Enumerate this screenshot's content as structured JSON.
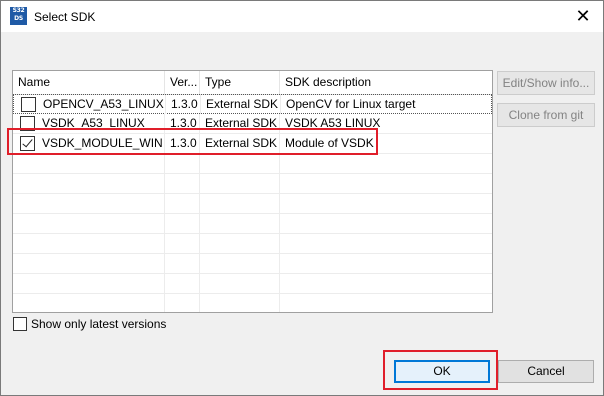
{
  "window": {
    "title": "Select SDK",
    "icon_lines": [
      "S32",
      "DS"
    ],
    "close_glyph": "✕"
  },
  "table": {
    "columns": [
      "Name",
      "Ver...",
      "Type",
      "SDK description"
    ],
    "rows": [
      {
        "checked": false,
        "name": "OPENCV_A53_LINUX",
        "version": "1.3.0",
        "type": "External SDK",
        "description": "OpenCV for Linux target"
      },
      {
        "checked": false,
        "name": "VSDK_A53_LINUX",
        "version": "1.3.0",
        "type": "External SDK",
        "description": "VSDK A53 LINUX"
      },
      {
        "checked": true,
        "name": "VSDK_MODULE_WIN",
        "version": "1.3.0",
        "type": "External SDK",
        "description": "Module of VSDK"
      }
    ]
  },
  "side_buttons": {
    "edit": "Edit/Show info...",
    "clone": "Clone from git"
  },
  "options": {
    "show_latest_label": "Show only latest versions",
    "show_latest_checked": false
  },
  "footer": {
    "ok_label": "OK",
    "cancel_label": "Cancel"
  },
  "colors": {
    "highlight": "#e01e2a",
    "default_button_border": "#0078d7"
  }
}
